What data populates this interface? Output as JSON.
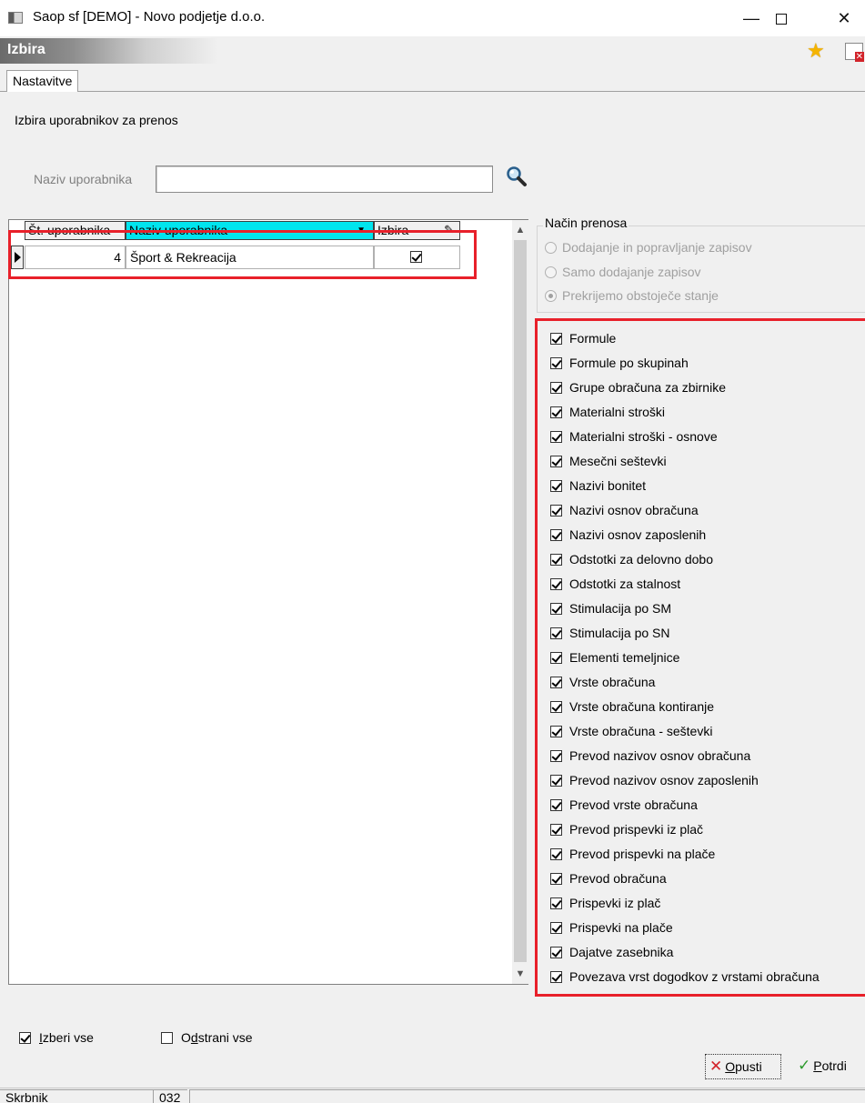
{
  "window": {
    "title": "Saop sf [DEMO] - Novo podjetje d.o.o.",
    "minimize": "—",
    "close": "✕"
  },
  "header": {
    "title": "Izbira"
  },
  "tabs": [
    {
      "label": "Nastavitve"
    }
  ],
  "section": {
    "label": "Izbira uporabnikov za prenos"
  },
  "search": {
    "label": "Naziv uporabnika",
    "value": ""
  },
  "grid": {
    "columns": [
      "Št. uporabnika",
      "Naziv uporabnika",
      "Izbira"
    ],
    "rows": [
      {
        "num": "4",
        "name": "Šport & Rekreacija",
        "selected": true
      }
    ]
  },
  "transfer_mode": {
    "title": "Način prenosa",
    "options": [
      {
        "label": "Dodajanje in popravljanje zapisov",
        "selected": false
      },
      {
        "label": "Samo dodajanje zapisov",
        "selected": false
      },
      {
        "label": "Prekrijemo obstoječe stanje",
        "selected": true
      }
    ]
  },
  "items": [
    "Formule",
    "Formule po skupinah",
    "Grupe obračuna za zbirnike",
    "Materialni stroški",
    "Materialni stroški - osnove",
    "Mesečni seštevki",
    "Nazivi bonitet",
    "Nazivi osnov obračuna",
    "Nazivi osnov zaposlenih",
    "Odstotki za delovno dobo",
    "Odstotki za stalnost",
    "Stimulacija po SM",
    "Stimulacija po SN",
    "Elementi temeljnice",
    "Vrste obračuna",
    "Vrste obračuna kontiranje",
    "Vrste obračuna - seštevki",
    "Prevod nazivov osnov obračuna",
    "Prevod nazivov osnov zaposlenih",
    "Prevod vrste obračuna",
    "Prevod prispevki iz plač",
    "Prevod prispevki na plače",
    "Prevod obračuna",
    "Prispevki iz plač",
    "Prispevki na plače",
    "Dajatve zasebnika",
    "Povezava vrst dogodkov z vrstami obračuna"
  ],
  "bottom": {
    "select_all_pre": "",
    "select_all_key": "I",
    "select_all_post": "zberi vse",
    "clear_all_pre": "O",
    "clear_all_key": "d",
    "clear_all_post": "strani vse"
  },
  "buttons": {
    "cancel_key": "O",
    "cancel_rest": "pusti",
    "confirm_key": "P",
    "confirm_rest": "otrdi"
  },
  "status": {
    "user": "Skrbnik",
    "code": "032",
    "message": ""
  },
  "colors": {
    "highlight": "#e8202a",
    "header_cell": "#00e5ee",
    "accent_star": "#f5b400"
  }
}
